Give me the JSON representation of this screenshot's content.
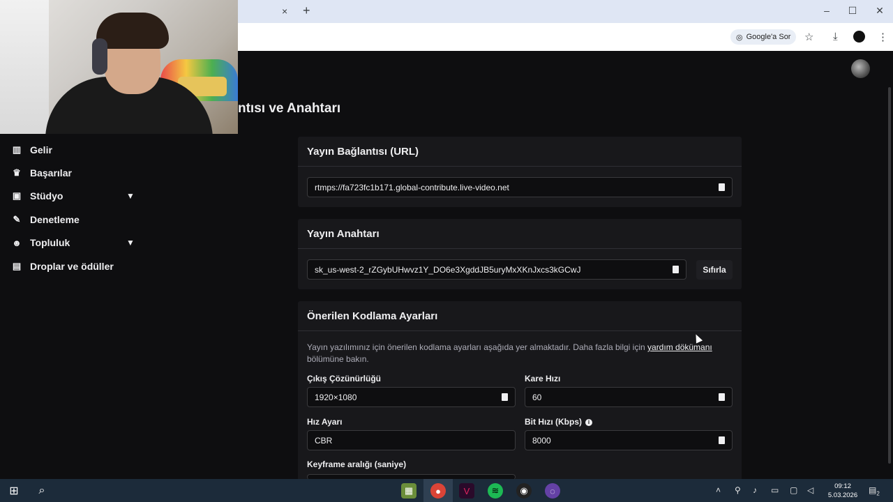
{
  "browser": {
    "tab_close": "×",
    "tab_new": "+",
    "google_sor": "Google'a Sor",
    "window_controls": [
      "–",
      "☐",
      "✕"
    ],
    "icons": [
      "google-lens-icon",
      "star-icon",
      "download-icon",
      "profile-icon",
      "menu-icon"
    ]
  },
  "page": {
    "title_partial": "ntısı ve Anahtarı"
  },
  "sidebar": {
    "items": [
      {
        "label": "Gelir",
        "icon": "chart-icon",
        "expandable": false
      },
      {
        "label": "Başarılar",
        "icon": "trophy-icon",
        "expandable": false
      },
      {
        "label": "Stüdyo",
        "icon": "studio-icon",
        "expandable": true
      },
      {
        "label": "Denetleme",
        "icon": "wrench-icon",
        "expandable": false
      },
      {
        "label": "Topluluk",
        "icon": "community-icon",
        "expandable": true
      },
      {
        "label": "Droplar ve ödüller",
        "icon": "gift-icon",
        "expandable": false
      }
    ]
  },
  "stream_url": {
    "heading": "Yayın Bağlantısı (URL)",
    "value": "rtmps://fa723fc1b171.global-contribute.live-video.net"
  },
  "stream_key": {
    "heading": "Yayın Anahtarı",
    "value": "sk_us-west-2_rZGybUHwvz1Y_DO6e3XgddJB5uryMxXKnJxcs3kGCwJ",
    "reset_label": "Sıfırla"
  },
  "encoding": {
    "heading": "Önerilen Kodlama Ayarları",
    "desc_before": "Yayın yazılımınız için önerilen kodlama ayarları aşağıda yer almaktadır. Daha fazla bilgi için ",
    "desc_link": "yardım dökümanı",
    "desc_after": " bölümüne bakın.",
    "resolution_label": "Çıkış Çözünürlüğü",
    "resolution_value": "1920×1080",
    "fps_label": "Kare Hızı",
    "fps_value": "60",
    "rate_control_label": "Hız Ayarı",
    "rate_control_value": "CBR",
    "bitrate_label": "Bit Hızı (Kbps)",
    "bitrate_value": "8000",
    "keyframe_label": "Keyframe aralığı (saniye)"
  },
  "taskbar": {
    "time": "09:12",
    "date": "5.03.2026",
    "notification_count": "2"
  }
}
